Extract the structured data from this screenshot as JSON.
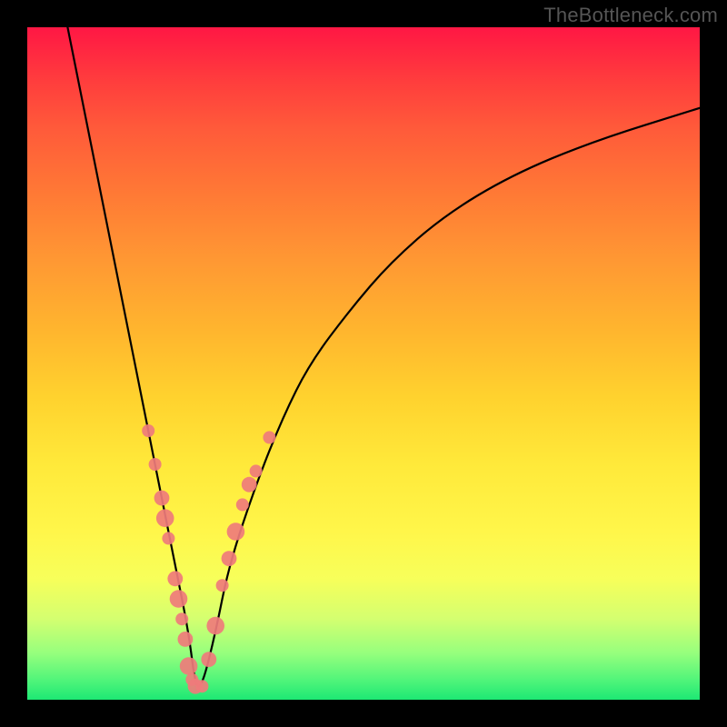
{
  "watermark": "TheBottleneck.com",
  "chart_data": {
    "type": "line",
    "title": "",
    "xlabel": "",
    "ylabel": "",
    "xlim": [
      0,
      100
    ],
    "ylim": [
      0,
      100
    ],
    "grid": false,
    "series": [
      {
        "name": "bottleneck-curve",
        "x": [
          6,
          8,
          10,
          12,
          14,
          16,
          18,
          20,
          22,
          24,
          25,
          26,
          28,
          30,
          34,
          38,
          42,
          48,
          54,
          62,
          72,
          84,
          100
        ],
        "values": [
          100,
          90,
          80,
          70,
          60,
          50,
          40,
          30,
          20,
          10,
          2,
          2,
          10,
          20,
          32,
          42,
          50,
          58,
          65,
          72,
          78,
          83,
          88
        ]
      }
    ],
    "points": {
      "name": "highlighted-points",
      "color": "#ef7b7b",
      "data": [
        {
          "x": 18,
          "y": 40,
          "r": 1.0
        },
        {
          "x": 19,
          "y": 35,
          "r": 1.0
        },
        {
          "x": 20,
          "y": 30,
          "r": 1.2
        },
        {
          "x": 20.5,
          "y": 27,
          "r": 1.4
        },
        {
          "x": 21,
          "y": 24,
          "r": 1.0
        },
        {
          "x": 22,
          "y": 18,
          "r": 1.2
        },
        {
          "x": 22.5,
          "y": 15,
          "r": 1.4
        },
        {
          "x": 23,
          "y": 12,
          "r": 1.0
        },
        {
          "x": 23.5,
          "y": 9,
          "r": 1.2
        },
        {
          "x": 24,
          "y": 5,
          "r": 1.4
        },
        {
          "x": 24.5,
          "y": 3,
          "r": 1.0
        },
        {
          "x": 25,
          "y": 2,
          "r": 1.2
        },
        {
          "x": 26,
          "y": 2,
          "r": 1.0
        },
        {
          "x": 27,
          "y": 6,
          "r": 1.2
        },
        {
          "x": 28,
          "y": 11,
          "r": 1.4
        },
        {
          "x": 29,
          "y": 17,
          "r": 1.0
        },
        {
          "x": 30,
          "y": 21,
          "r": 1.2
        },
        {
          "x": 31,
          "y": 25,
          "r": 1.4
        },
        {
          "x": 32,
          "y": 29,
          "r": 1.0
        },
        {
          "x": 33,
          "y": 32,
          "r": 1.2
        },
        {
          "x": 34,
          "y": 34,
          "r": 1.0
        },
        {
          "x": 36,
          "y": 39,
          "r": 1.0
        }
      ]
    },
    "background_gradient": {
      "top": "#ff1744",
      "mid": "#ffe93a",
      "bottom": "#1de874"
    }
  }
}
